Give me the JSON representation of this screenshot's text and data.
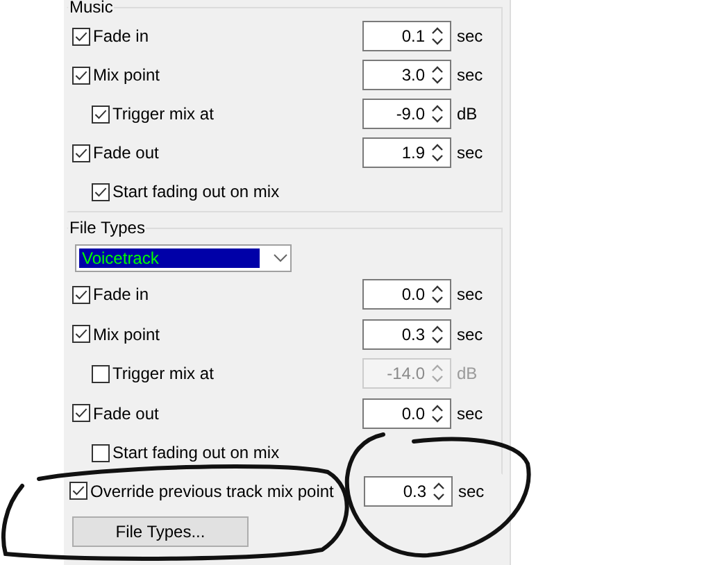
{
  "music": {
    "title": "Music",
    "rows": [
      {
        "label": "Fade in",
        "checked": true,
        "value": "0.1",
        "unit": "sec",
        "disabled": false
      },
      {
        "label": "Mix point",
        "checked": true,
        "value": "3.0",
        "unit": "sec",
        "disabled": false,
        "children": [
          {
            "label": "Trigger mix at",
            "checked": true,
            "value": "-9.0",
            "unit": "dB",
            "disabled": false
          }
        ]
      },
      {
        "label": "Fade out",
        "checked": true,
        "value": "1.9",
        "unit": "sec",
        "disabled": false,
        "children": [
          {
            "label": "Start fading out on mix",
            "checked": true
          }
        ]
      }
    ]
  },
  "file_types": {
    "title": "File Types",
    "dropdown": {
      "value": "Voicetrack"
    },
    "rows": [
      {
        "label": "Fade in",
        "checked": true,
        "value": "0.0",
        "unit": "sec",
        "disabled": false
      },
      {
        "label": "Mix point",
        "checked": true,
        "value": "0.3",
        "unit": "sec",
        "disabled": false,
        "children": [
          {
            "label": "Trigger mix at",
            "checked": false,
            "value": "-14.0",
            "unit": "dB",
            "disabled": true
          }
        ]
      },
      {
        "label": "Fade out",
        "checked": true,
        "value": "0.0",
        "unit": "sec",
        "disabled": false,
        "children": [
          {
            "label": "Start fading out on mix",
            "checked": false
          }
        ]
      }
    ]
  },
  "override": {
    "label": "Override previous track mix point",
    "checked": true,
    "value": "0.3",
    "unit": "sec",
    "disabled": false
  },
  "file_types_button": "File Types..."
}
